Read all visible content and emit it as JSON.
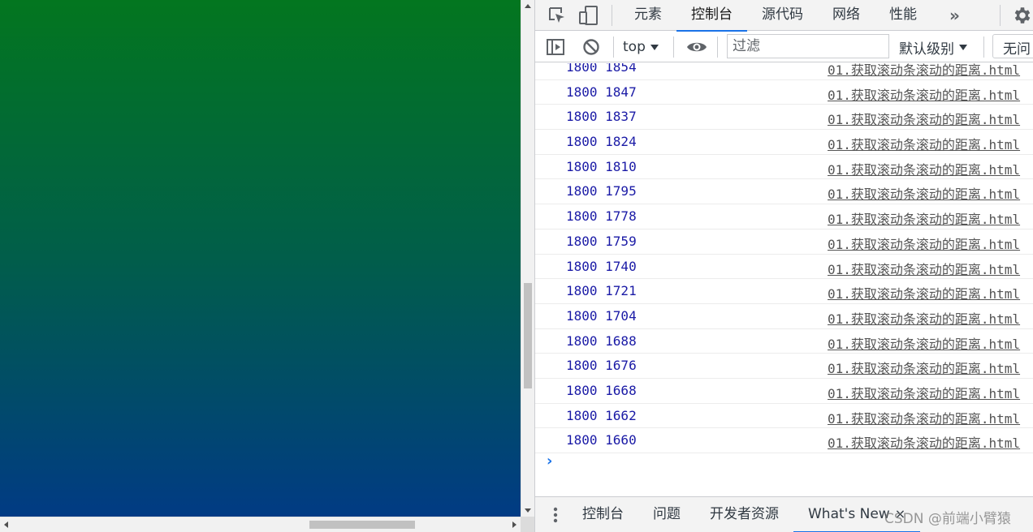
{
  "devtools": {
    "tabs": [
      {
        "label": "元素",
        "active": false
      },
      {
        "label": "控制台",
        "active": true
      },
      {
        "label": "源代码",
        "active": false
      },
      {
        "label": "网络",
        "active": false
      },
      {
        "label": "性能",
        "active": false
      }
    ],
    "more_tabs_glyph": "»",
    "toolbar": {
      "context": "top",
      "filter_placeholder": "过滤",
      "levels": "默认级别",
      "issues": "无问"
    },
    "console_rows": [
      {
        "message": "1800 1854",
        "source": "01.获取滚动条滚动的距离.html"
      },
      {
        "message": "1800 1847",
        "source": "01.获取滚动条滚动的距离.html"
      },
      {
        "message": "1800 1837",
        "source": "01.获取滚动条滚动的距离.html"
      },
      {
        "message": "1800 1824",
        "source": "01.获取滚动条滚动的距离.html"
      },
      {
        "message": "1800 1810",
        "source": "01.获取滚动条滚动的距离.html"
      },
      {
        "message": "1800 1795",
        "source": "01.获取滚动条滚动的距离.html"
      },
      {
        "message": "1800 1778",
        "source": "01.获取滚动条滚动的距离.html"
      },
      {
        "message": "1800 1759",
        "source": "01.获取滚动条滚动的距离.html"
      },
      {
        "message": "1800 1740",
        "source": "01.获取滚动条滚动的距离.html"
      },
      {
        "message": "1800 1721",
        "source": "01.获取滚动条滚动的距离.html"
      },
      {
        "message": "1800 1704",
        "source": "01.获取滚动条滚动的距离.html"
      },
      {
        "message": "1800 1688",
        "source": "01.获取滚动条滚动的距离.html"
      },
      {
        "message": "1800 1676",
        "source": "01.获取滚动条滚动的距离.html"
      },
      {
        "message": "1800 1668",
        "source": "01.获取滚动条滚动的距离.html"
      },
      {
        "message": "1800 1662",
        "source": "01.获取滚动条滚动的距离.html"
      },
      {
        "message": "1800 1660",
        "source": "01.获取滚动条滚动的距离.html"
      }
    ],
    "prompt_glyph": "›",
    "drawer": {
      "tabs": [
        {
          "label": "控制台",
          "active": false
        },
        {
          "label": "问题",
          "active": false
        },
        {
          "label": "开发者资源",
          "active": false
        },
        {
          "label": "What's New",
          "active": true
        }
      ],
      "close_glyph": "×",
      "watermark": "CSDN @前端小臂猿"
    }
  },
  "colors": {
    "gradient_top": "#03761f",
    "gradient_bottom": "#013b84",
    "console_message": "#1a1aa6",
    "accent": "#1a73e8"
  }
}
